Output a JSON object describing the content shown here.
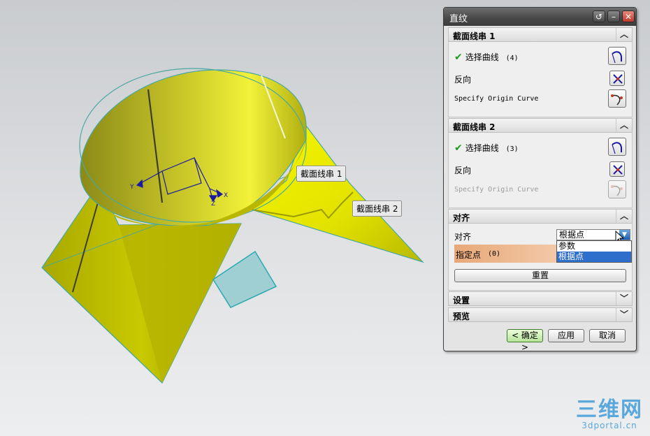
{
  "viewport": {
    "callout1": "截面线串 1",
    "callout2": "截面线串 2",
    "axis_labels": {
      "x": "X",
      "y": "Y",
      "z": "Z"
    }
  },
  "dialog": {
    "title": "直纹",
    "section1": {
      "header": "截面线串 1",
      "select_curve_label": "选择曲线",
      "select_curve_count": "(4)",
      "reverse_label": "反向",
      "origin_curve_label": "Specify Origin Curve"
    },
    "section2": {
      "header": "截面线串 2",
      "select_curve_label": "选择曲线",
      "select_curve_count": "(3)",
      "reverse_label": "反向",
      "origin_curve_label": "Specify Origin Curve"
    },
    "alignment": {
      "header": "对齐",
      "label": "对齐",
      "selected": "根据点",
      "options": [
        "参数",
        "根据点"
      ],
      "specify_point_label": "指定点",
      "specify_point_count": "(0)",
      "reset_label": "重置"
    },
    "settings_header": "设置",
    "preview_header": "预览",
    "buttons": {
      "ok": "< 确定 >",
      "apply": "应用",
      "cancel": "取消"
    }
  },
  "watermark": {
    "main": "三维网",
    "sub": "3dportal.cn"
  },
  "colors": {
    "surface": "#d4d400",
    "edge": "#4aa8a0",
    "accent": "#2f6fcc",
    "check": "#1c9a1c"
  }
}
